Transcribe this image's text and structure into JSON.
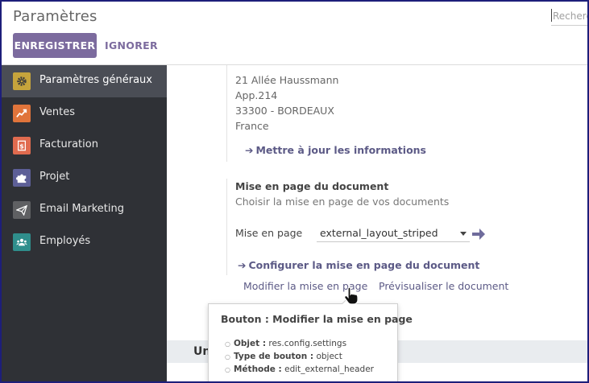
{
  "header": {
    "title": "Paramètres",
    "search_placeholder": "Recherc",
    "save_label": "ENREGISTRER",
    "discard_label": "IGNORER"
  },
  "sidebar": {
    "items": [
      {
        "label": "Paramètres généraux",
        "icon": "gear-icon",
        "color": "#c6a43c",
        "active": true
      },
      {
        "label": "Ventes",
        "icon": "chart-line-icon",
        "color": "#e0743b",
        "active": false
      },
      {
        "label": "Facturation",
        "icon": "dollar-icon",
        "color": "#e06b4f",
        "active": false
      },
      {
        "label": "Projet",
        "icon": "puzzle-icon",
        "color": "#5d5f97",
        "active": false
      },
      {
        "label": "Email Marketing",
        "icon": "paper-plane-icon",
        "color": "#5f6063",
        "active": false
      },
      {
        "label": "Employés",
        "icon": "users-icon",
        "color": "#2f8e8c",
        "active": false
      }
    ]
  },
  "company": {
    "address": [
      "21 Allée Haussmann",
      "App.214",
      "33300 - BORDEAUX",
      "France"
    ],
    "update_link": "Mettre à jour les informations"
  },
  "layout": {
    "title": "Mise en page du document",
    "description": "Choisir la mise en page de vos documents",
    "field_label": "Mise en page",
    "field_value": "external_layout_striped",
    "configure_link": "Configurer la mise en page du document",
    "edit_link": "Modifier la mise en page",
    "preview_link": "Prévisualiser le document"
  },
  "next_section": {
    "title": "Un"
  },
  "tooltip": {
    "title": "Bouton : Modifier la mise en page",
    "rows": [
      {
        "key": "Objet :",
        "value": "res.config.settings"
      },
      {
        "key": "Type de bouton :",
        "value": "object"
      },
      {
        "key": "Méthode :",
        "value": "edit_external_header"
      }
    ]
  },
  "colors": {
    "brand": "#7c6b9e",
    "link": "#5c5a86",
    "sidebar_bg": "#2f3136",
    "sidebar_active": "#4a4d55"
  }
}
